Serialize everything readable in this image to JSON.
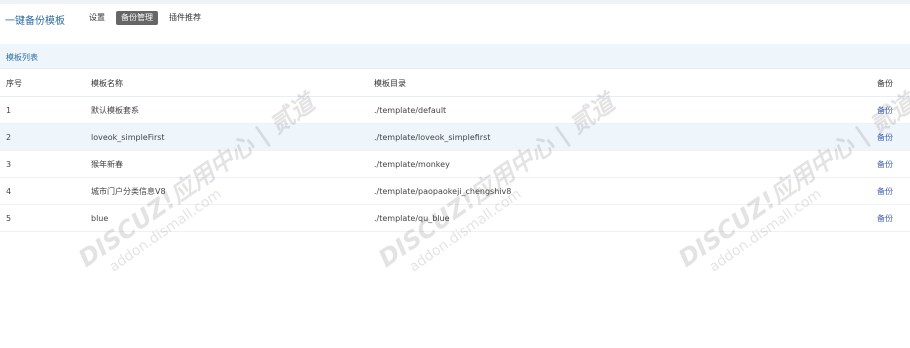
{
  "header": {
    "app_title": "一键备份模板",
    "nav": [
      {
        "label": "设置",
        "active": false
      },
      {
        "label": "备份管理",
        "active": true
      },
      {
        "label": "插件推荐",
        "active": false
      }
    ]
  },
  "section": {
    "title": "模板列表"
  },
  "table": {
    "headers": [
      "序号",
      "模板名称",
      "模板目录",
      "备份"
    ],
    "rows": [
      {
        "no": "1",
        "name": "默认模板套系",
        "dir": "./template/default",
        "action": "备份"
      },
      {
        "no": "2",
        "name": "loveok_simpleFirst",
        "dir": "./template/loveok_simplefirst",
        "action": "备份"
      },
      {
        "no": "3",
        "name": "猴年新春",
        "dir": "./template/monkey",
        "action": "备份"
      },
      {
        "no": "4",
        "name": "城市门户分类信息V8",
        "dir": "./template/paopaokeji_chengshiv8",
        "action": "备份"
      },
      {
        "no": "5",
        "name": "blue",
        "dir": "./template/qu_blue",
        "action": "备份"
      }
    ]
  },
  "watermark": {
    "line1": "DISCUZ!应用中心 | 贰道",
    "line2": "addon.dismall.com"
  }
}
